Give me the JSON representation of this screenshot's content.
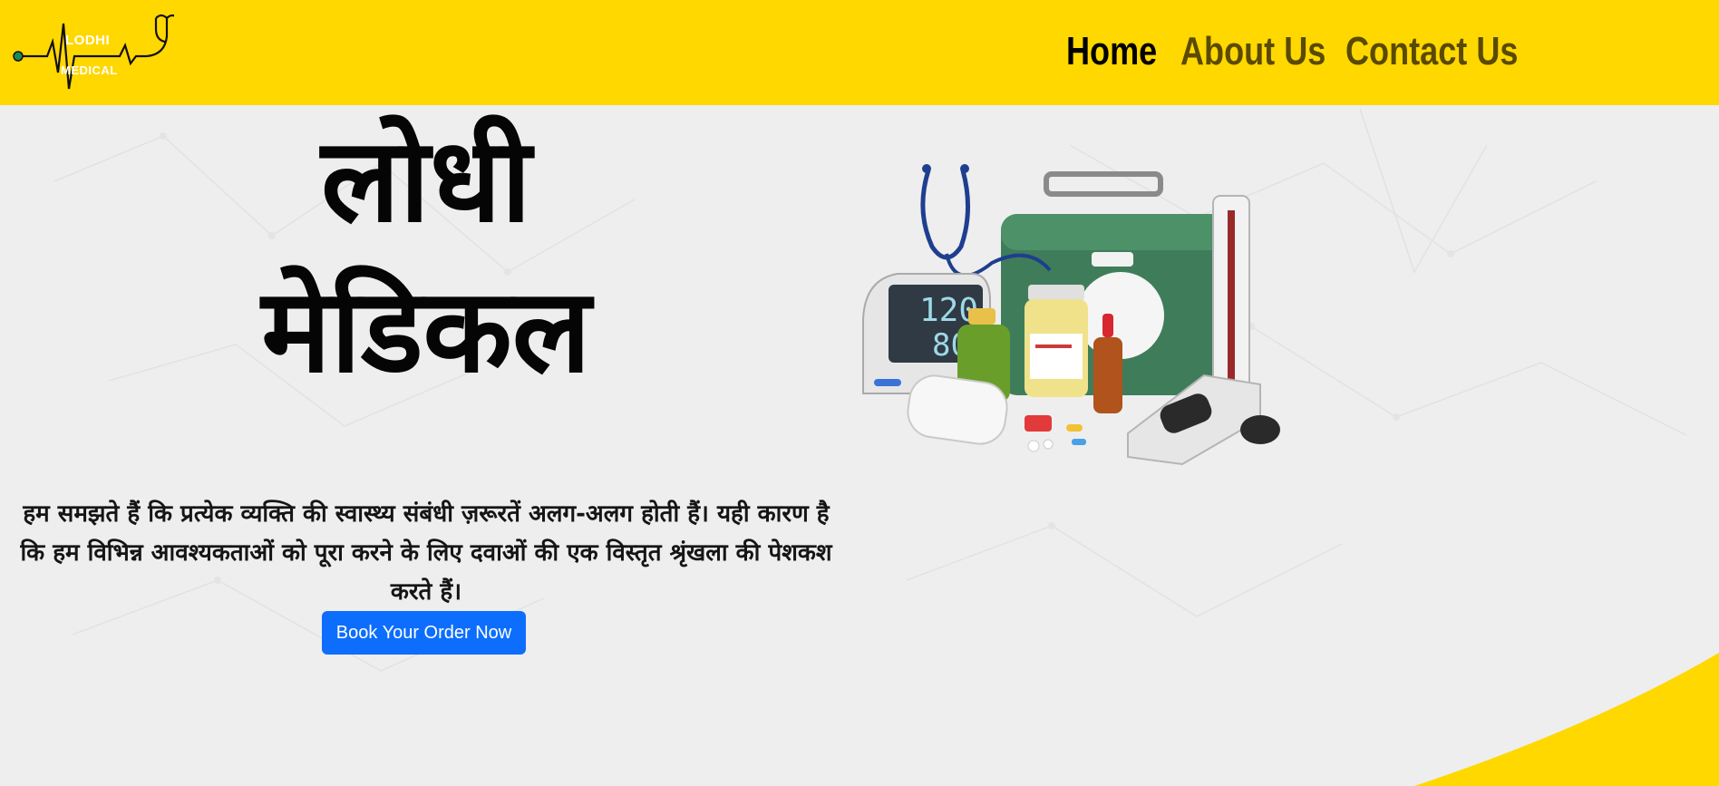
{
  "brand": {
    "logo_line1": "LODHI",
    "logo_line2": "MEDICAL"
  },
  "nav": {
    "home": "Home",
    "about": "About Us",
    "contact": "Contact Us"
  },
  "hero": {
    "title_line1": "लोधी",
    "title_line2": "मेडिकल",
    "tagline": "हम समझते हैं कि प्रत्येक व्यक्ति की स्वास्थ्य संबंधी ज़रूरतें अलग-अलग होती हैं। यही कारण है कि हम विभिन्न आवश्यकताओं को पूरा करने के लिए दवाओं की एक विस्तृत श्रृंखला की पेशकश करते हैं।",
    "cta_label": "Book Your Order Now",
    "cta_color": "#0d6efd"
  },
  "theme": {
    "header_bg": "#ffd800",
    "page_bg": "#eeeeee",
    "accent_yellow": "#ffd800"
  },
  "illustration": {
    "monitor_reading_top": "120",
    "monitor_reading_bottom": "80"
  }
}
